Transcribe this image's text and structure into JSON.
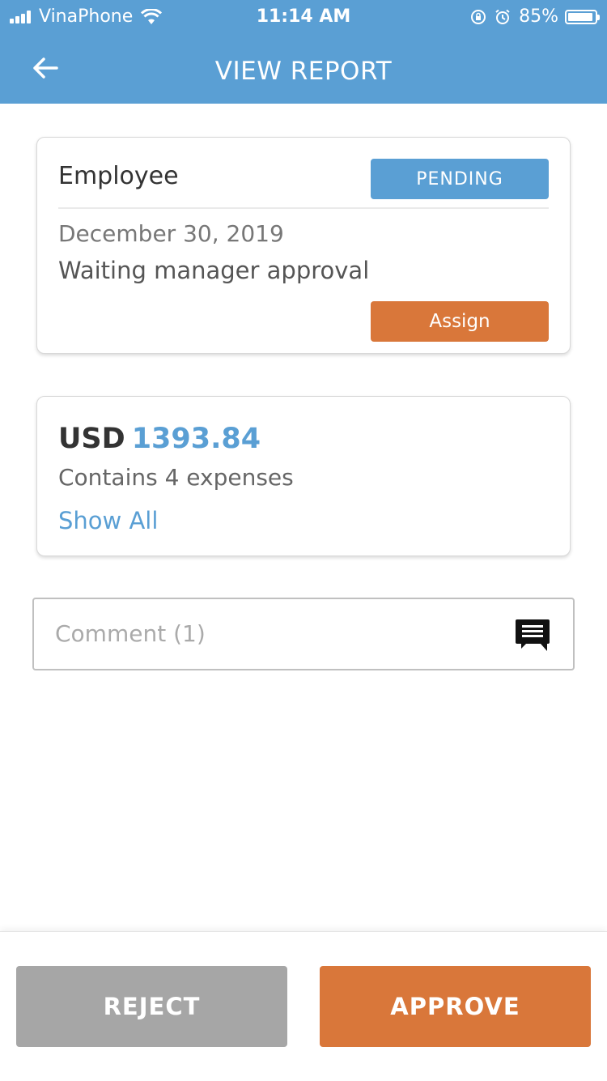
{
  "status_bar": {
    "carrier": "VinaPhone",
    "time": "11:14 AM",
    "battery": "85%",
    "battery_level": 0.85,
    "icons": [
      "signal-icon",
      "wifi-icon",
      "orientation-lock-icon",
      "alarm-icon",
      "battery-icon"
    ]
  },
  "header": {
    "title": "VIEW REPORT",
    "back_icon": "arrow-left-icon"
  },
  "report": {
    "employee_label": "Employee",
    "status_badge": "PENDING",
    "date": "December 30, 2019",
    "status_text": "Waiting manager approval",
    "assign_label": "Assign"
  },
  "amount": {
    "currency": "USD",
    "value": "1393.84",
    "contains": "Contains 4 expenses",
    "show_all": "Show All"
  },
  "comment": {
    "label": "Comment (1)",
    "icon": "comment-icon"
  },
  "actions": {
    "reject": "REJECT",
    "approve": "APPROVE"
  },
  "colors": {
    "header": "#5a9fd4",
    "accent_orange": "#d9773a",
    "reject_gray": "#a6a6a6",
    "link_blue": "#5a9fd4"
  }
}
